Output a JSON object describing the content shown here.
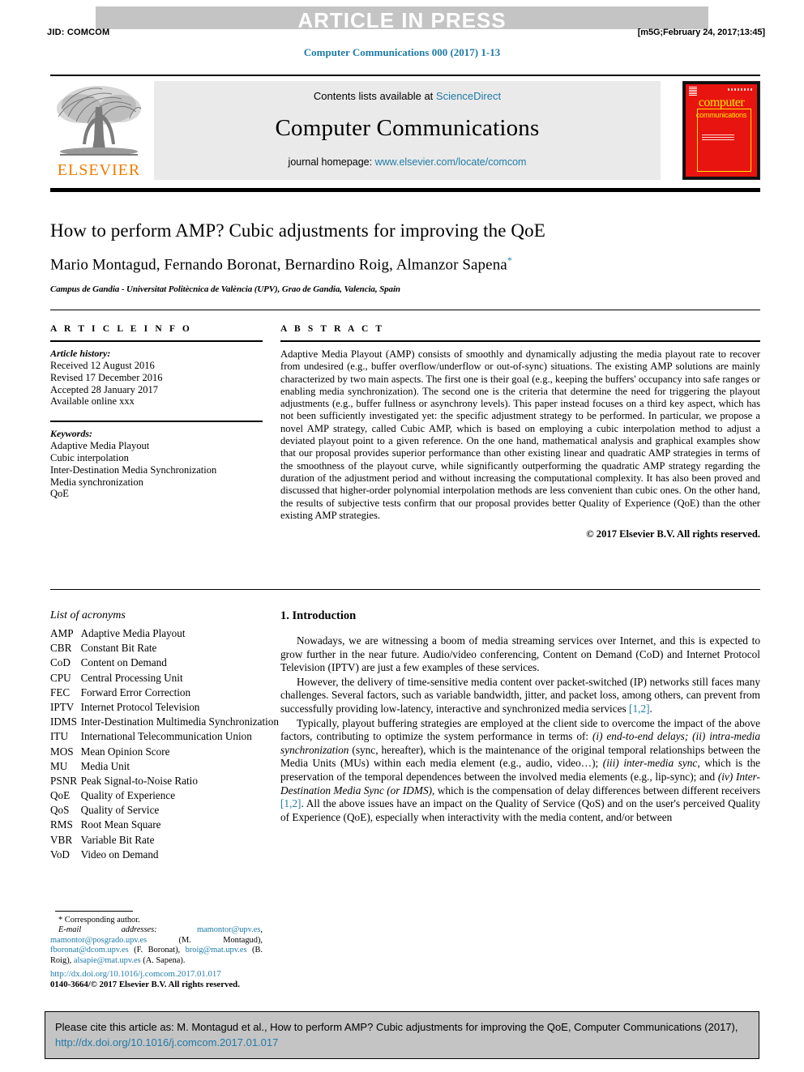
{
  "running_head": {
    "banner": "ARTICLE IN PRESS",
    "jid": "JID: COMCOM",
    "stamp": "[m5G;February 24, 2017;13:45]",
    "journal_ref": "Computer Communications 000 (2017) 1-13"
  },
  "masthead": {
    "publisher": "ELSEVIER",
    "contents_prefix": "Contents lists available at ",
    "contents_link": "ScienceDirect",
    "journal_title": "Computer Communications",
    "homepage_prefix": "journal homepage: ",
    "homepage_link": "www.elsevier.com/locate/comcom",
    "cover_word1": "computer",
    "cover_word2": "communications"
  },
  "article": {
    "title": "How to perform AMP? Cubic adjustments for improving the QoE",
    "authors": "Mario Montagud, Fernando Boronat, Bernardino Roig, Almanzor Sapena",
    "author_marker": "*",
    "affiliation": "Campus de Gandia - Universitat Politècnica de València (UPV), Grao de Gandia, Valencia, Spain"
  },
  "info": {
    "heading": "A R T I C L E   I N F O",
    "history_title": "Article history:",
    "history": [
      "Received 12 August 2016",
      "Revised 17 December 2016",
      "Accepted 28 January 2017",
      "Available online xxx"
    ],
    "keywords_title": "Keywords:",
    "keywords": [
      "Adaptive Media Playout",
      "Cubic interpolation",
      "Inter-Destination Media Synchronization",
      "Media synchronization",
      "QoE"
    ]
  },
  "abstract": {
    "heading": "A B S T R A C T",
    "body": "Adaptive Media Playout (AMP) consists of smoothly and dynamically adjusting the media playout rate to recover from undesired (e.g., buffer overflow/underflow or out-of-sync) situations. The existing AMP solutions are mainly characterized by two main aspects. The first one is their goal (e.g., keeping the buffers' occupancy into safe ranges or enabling media synchronization). The second one is the criteria that determine the need for triggering the playout adjustments (e.g., buffer fullness or asynchrony levels). This paper instead focuses on a third key aspect, which has not been sufficiently investigated yet: the specific adjustment strategy to be performed. In particular, we propose a novel AMP strategy, called Cubic AMP, which is based on employing a cubic interpolation method to adjust a deviated playout point to a given reference. On the one hand, mathematical analysis and graphical examples show that our proposal provides superior performance than other existing linear and quadratic AMP strategies in terms of the smoothness of the playout curve, while significantly outperforming the quadratic AMP strategy regarding the duration of the adjustment period and without increasing the computational complexity. It has also been proved and discussed that higher-order polynomial interpolation methods are less convenient than cubic ones. On the other hand, the results of subjective tests confirm that our proposal provides better Quality of Experience (QoE) than the other existing AMP strategies.",
    "copyright": "© 2017 Elsevier B.V. All rights reserved."
  },
  "acronyms": {
    "heading": "List of acronyms",
    "items": [
      {
        "key": "AMP",
        "value": "Adaptive Media Playout"
      },
      {
        "key": "CBR",
        "value": "Constant Bit Rate"
      },
      {
        "key": "CoD",
        "value": "Content on Demand"
      },
      {
        "key": "CPU",
        "value": "Central Processing Unit"
      },
      {
        "key": "FEC",
        "value": "Forward Error Correction"
      },
      {
        "key": "IPTV",
        "value": "Internet Protocol Television"
      },
      {
        "key": "IDMS",
        "value": "Inter-Destination Multimedia Synchronization"
      },
      {
        "key": "ITU",
        "value": "International Telecommunication Union"
      },
      {
        "key": "MOS",
        "value": "Mean Opinion Score"
      },
      {
        "key": "MU",
        "value": "Media Unit"
      },
      {
        "key": "PSNR",
        "value": "Peak Signal-to-Noise Ratio"
      },
      {
        "key": "QoE",
        "value": "Quality of Experience"
      },
      {
        "key": "QoS",
        "value": "Quality of Service"
      },
      {
        "key": "RMS",
        "value": "Root Mean Square"
      },
      {
        "key": "VBR",
        "value": "Variable Bit Rate"
      },
      {
        "key": "VoD",
        "value": "Video on Demand"
      }
    ]
  },
  "introduction": {
    "heading": "1. Introduction",
    "p1": "Nowadays, we are witnessing a boom of media streaming services over Internet, and this is expected to grow further in the near future. Audio/video conferencing, Content on Demand (CoD) and Internet Protocol Television (IPTV) are just a few examples of these services.",
    "p2_a": "However, the delivery of time-sensitive media content over packet-switched (IP) networks still faces many challenges. Several factors, such as variable bandwidth, jitter, and packet loss, among others, can prevent from successfully providing low-latency, interactive and synchronized media services ",
    "p2_ref": "[1,2]",
    "p2_b": ".",
    "p3_a": "Typically, playout buffering strategies are employed at the client side to overcome the impact of the above factors, contributing to optimize the system performance in terms of: ",
    "p3_i1": "(i) end-to-end delays;",
    "p3_i2": "(ii) intra-media synchronization",
    "p3_b": " (sync, hereafter), which is the maintenance of the original temporal relationships between the Media Units (MUs) within each media element (e.g., audio, video…); ",
    "p3_i3": "(iii) inter-media sync",
    "p3_c": ", which is the preservation of the temporal dependences between the involved media elements (e.g., lip-sync); and ",
    "p3_i4": "(iv) Inter-Destination Media Sync (or IDMS)",
    "p3_d": ", which is the compensation of delay differences between different receivers ",
    "p3_ref": "[1,2]",
    "p3_e": ". All the above issues have an impact on the Quality of Service (QoS) and on the user's perceived Quality of Experience (QoE), especially when interactivity with the media content, and/or between"
  },
  "footnotes": {
    "corresponding": "* Corresponding author.",
    "email_label": "E-mail addresses:",
    "emails": [
      {
        "addr": "mamontor@upv.es",
        "sep": ", "
      },
      {
        "addr": "mamontor@posgrado.upv.es",
        "sep": " (M. Montagud), "
      },
      {
        "addr": "fboronat@dcom.upv.es",
        "sep": " (F. Boronat), "
      },
      {
        "addr": "broig@mat.upv.es",
        "sep": " (B. Roig), "
      },
      {
        "addr": "alsapie@mat.upv.es",
        "sep": " (A. Sapena)."
      }
    ],
    "doi": "http://dx.doi.org/10.1016/j.comcom.2017.01.017",
    "issn": "0140-3664/© 2017 Elsevier B.V. All rights reserved."
  },
  "cite_box": {
    "text_a": "Please cite this article as: M. Montagud et al., How to perform AMP? Cubic adjustments for improving the QoE, Computer Communications (2017), ",
    "link": "http://dx.doi.org/10.1016/j.comcom.2017.01.017"
  },
  "colors": {
    "link": "#1f7ba6",
    "elsevier_orange": "#ef7d00",
    "cover_red": "#e8140f",
    "cover_yellow": "#ffe600",
    "banner_gray": "#c4c4c4"
  }
}
